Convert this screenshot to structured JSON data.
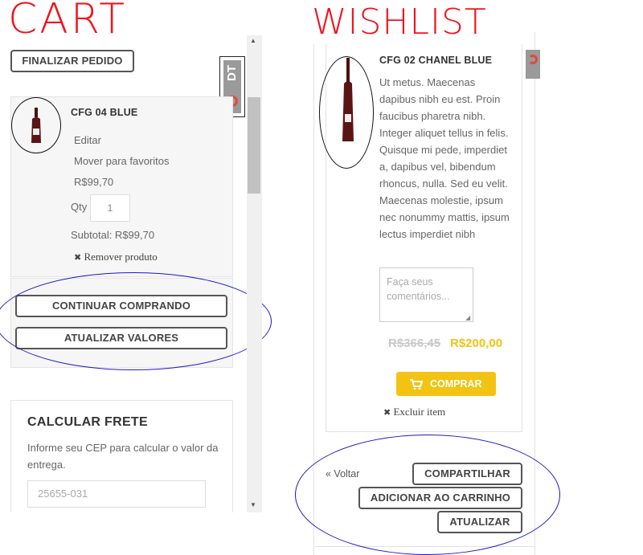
{
  "annotations": {
    "cart_label": "CART",
    "wishlist_label": "WISHLIST"
  },
  "cart": {
    "finalize_button": "FINALIZAR PEDIDO",
    "product": {
      "name": "CFG 04 BLUE",
      "edit_link": "Editar",
      "move_link": "Mover para favoritos",
      "price": "R$99,70",
      "qty_label": "Qty",
      "qty_value": "1",
      "subtotal": "Subtotal: R$99,70",
      "remove_link": "Remover produto"
    },
    "continue_button": "CONTINUAR COMPRANDO",
    "update_button": "ATUALIZAR VALORES",
    "shipping": {
      "title": "CALCULAR FRETE",
      "description": "Informe seu CEP para calcular o valor da entrega.",
      "cep_placeholder": "25655-031"
    },
    "debug_toolbar": "DT"
  },
  "wishlist": {
    "product": {
      "name": "CFG 02 CHANEL BLUE",
      "description": "Ut metus. Maecenas dapibus nibh eu est. Proin faucibus pharetra nibh. Integer aliquet tellus in felis. Quisque mi pede, imperdiet a, dapibus vel, bibendum rhoncus, nulla. Sed eu velit. Maecenas molestie, ipsum nec nonummy mattis, ipsum lectus imperdiet nibh",
      "comment_placeholder": "Faça seus comentários...",
      "old_price": "R$366,45",
      "new_price": "R$200,00",
      "buy_button": "COMPRAR",
      "remove_link": "Excluir item"
    },
    "back_link": "« Voltar",
    "share_button": "COMPARTILHAR",
    "add_to_cart_button": "ADICIONAR AO CARRINHO",
    "update_button": "ATUALIZAR"
  },
  "colors": {
    "accent_yellow": "#f2c313",
    "price_yellow": "#f2c313",
    "annotation_red": "#f0141e",
    "annotation_blue": "#1818c8"
  }
}
